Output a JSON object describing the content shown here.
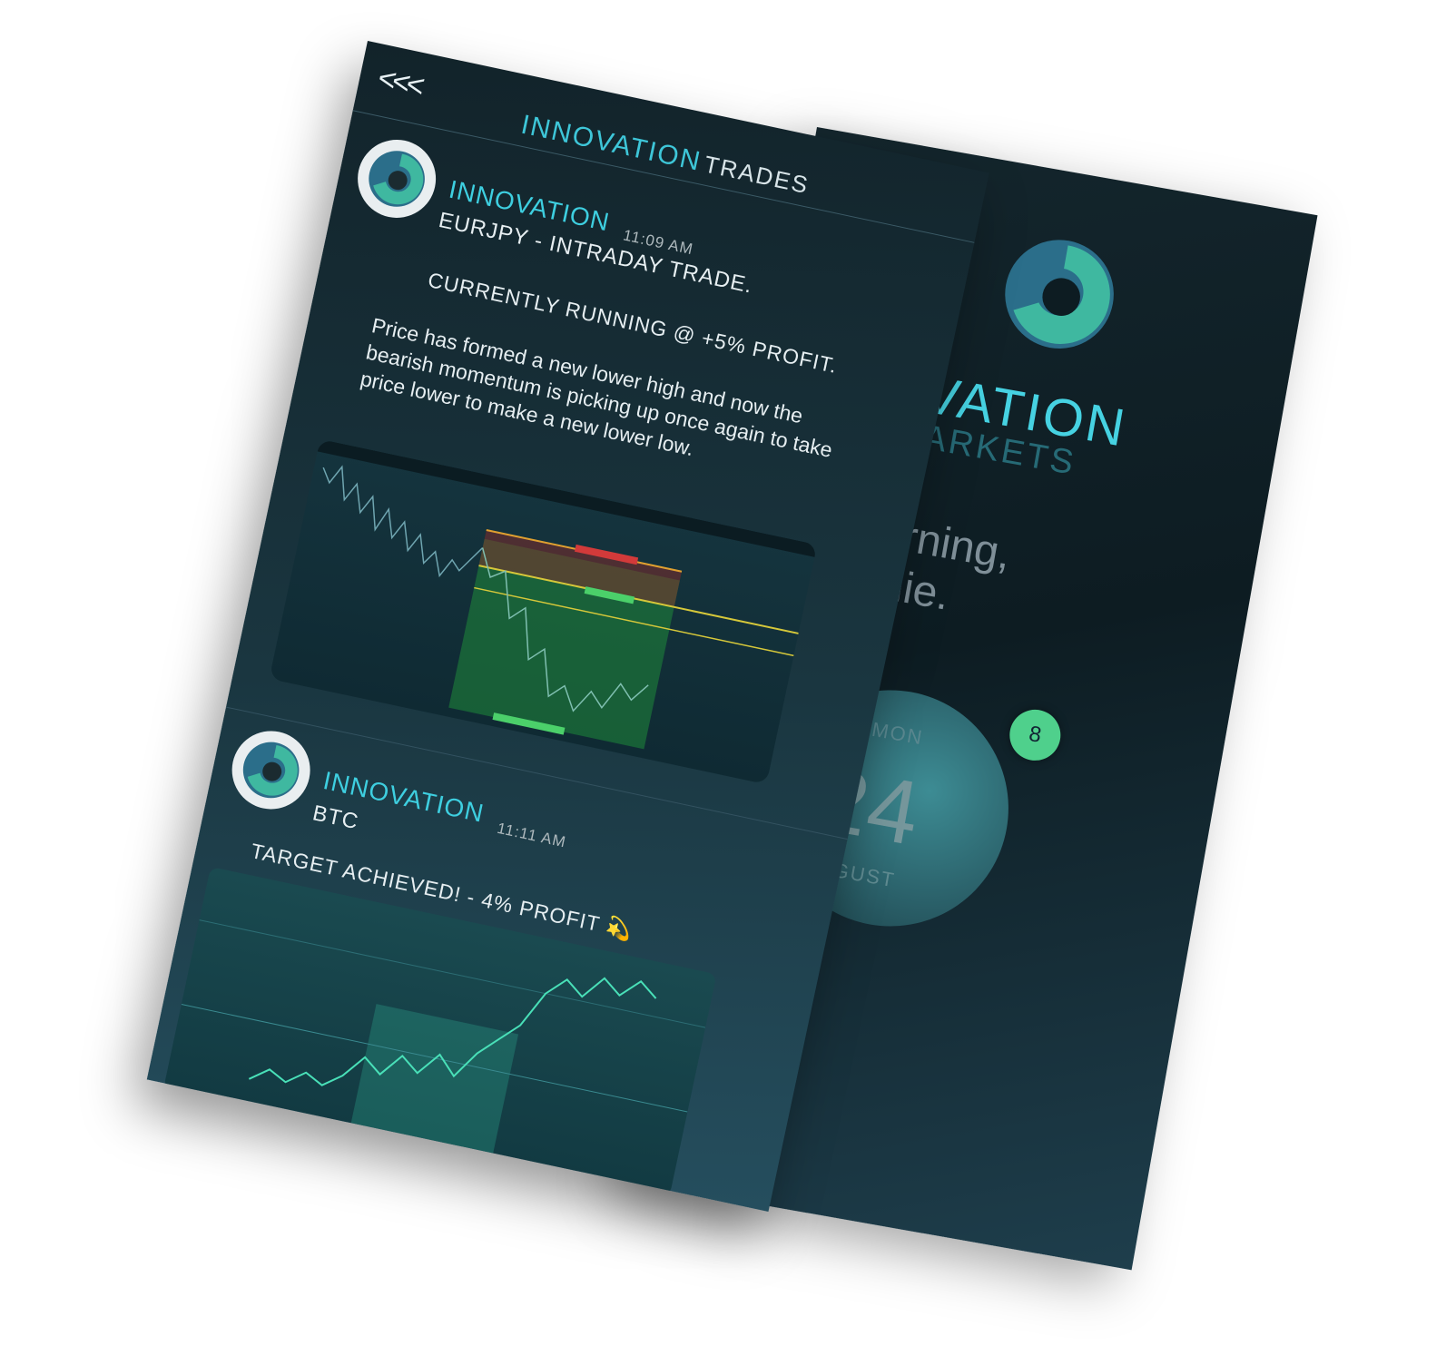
{
  "back_screen": {
    "brand_main": "OVATION",
    "brand_sub": "ARKETS",
    "greeting_line1": "Morning,",
    "greeting_line2": "ernie.",
    "date": {
      "day": "MON",
      "number": "24",
      "month": "UGUST"
    },
    "notification_count": "8",
    "scroll_hint": "<<"
  },
  "front_screen": {
    "back_label": "<<<",
    "title_highlight": "INNOVATION",
    "title_rest": "TRADES",
    "posts": [
      {
        "author": "INNOVATION",
        "time": "11:09 AM",
        "symbol_line": "EURJPY - INTRADAY TRADE.",
        "status_line": "CURRENTLY RUNNING  @ +5%  PROFIT.",
        "body": "Price has formed a new lower high and now the bearish momentum is picking up once again to take price lower to make a new lower low."
      },
      {
        "author": "INNOVATION",
        "time": "11:11 AM",
        "symbol_line": "BTC",
        "status_line": "TARGET ACHIEVED! - 4% PROFIT",
        "status_emoji": "💫"
      }
    ]
  }
}
